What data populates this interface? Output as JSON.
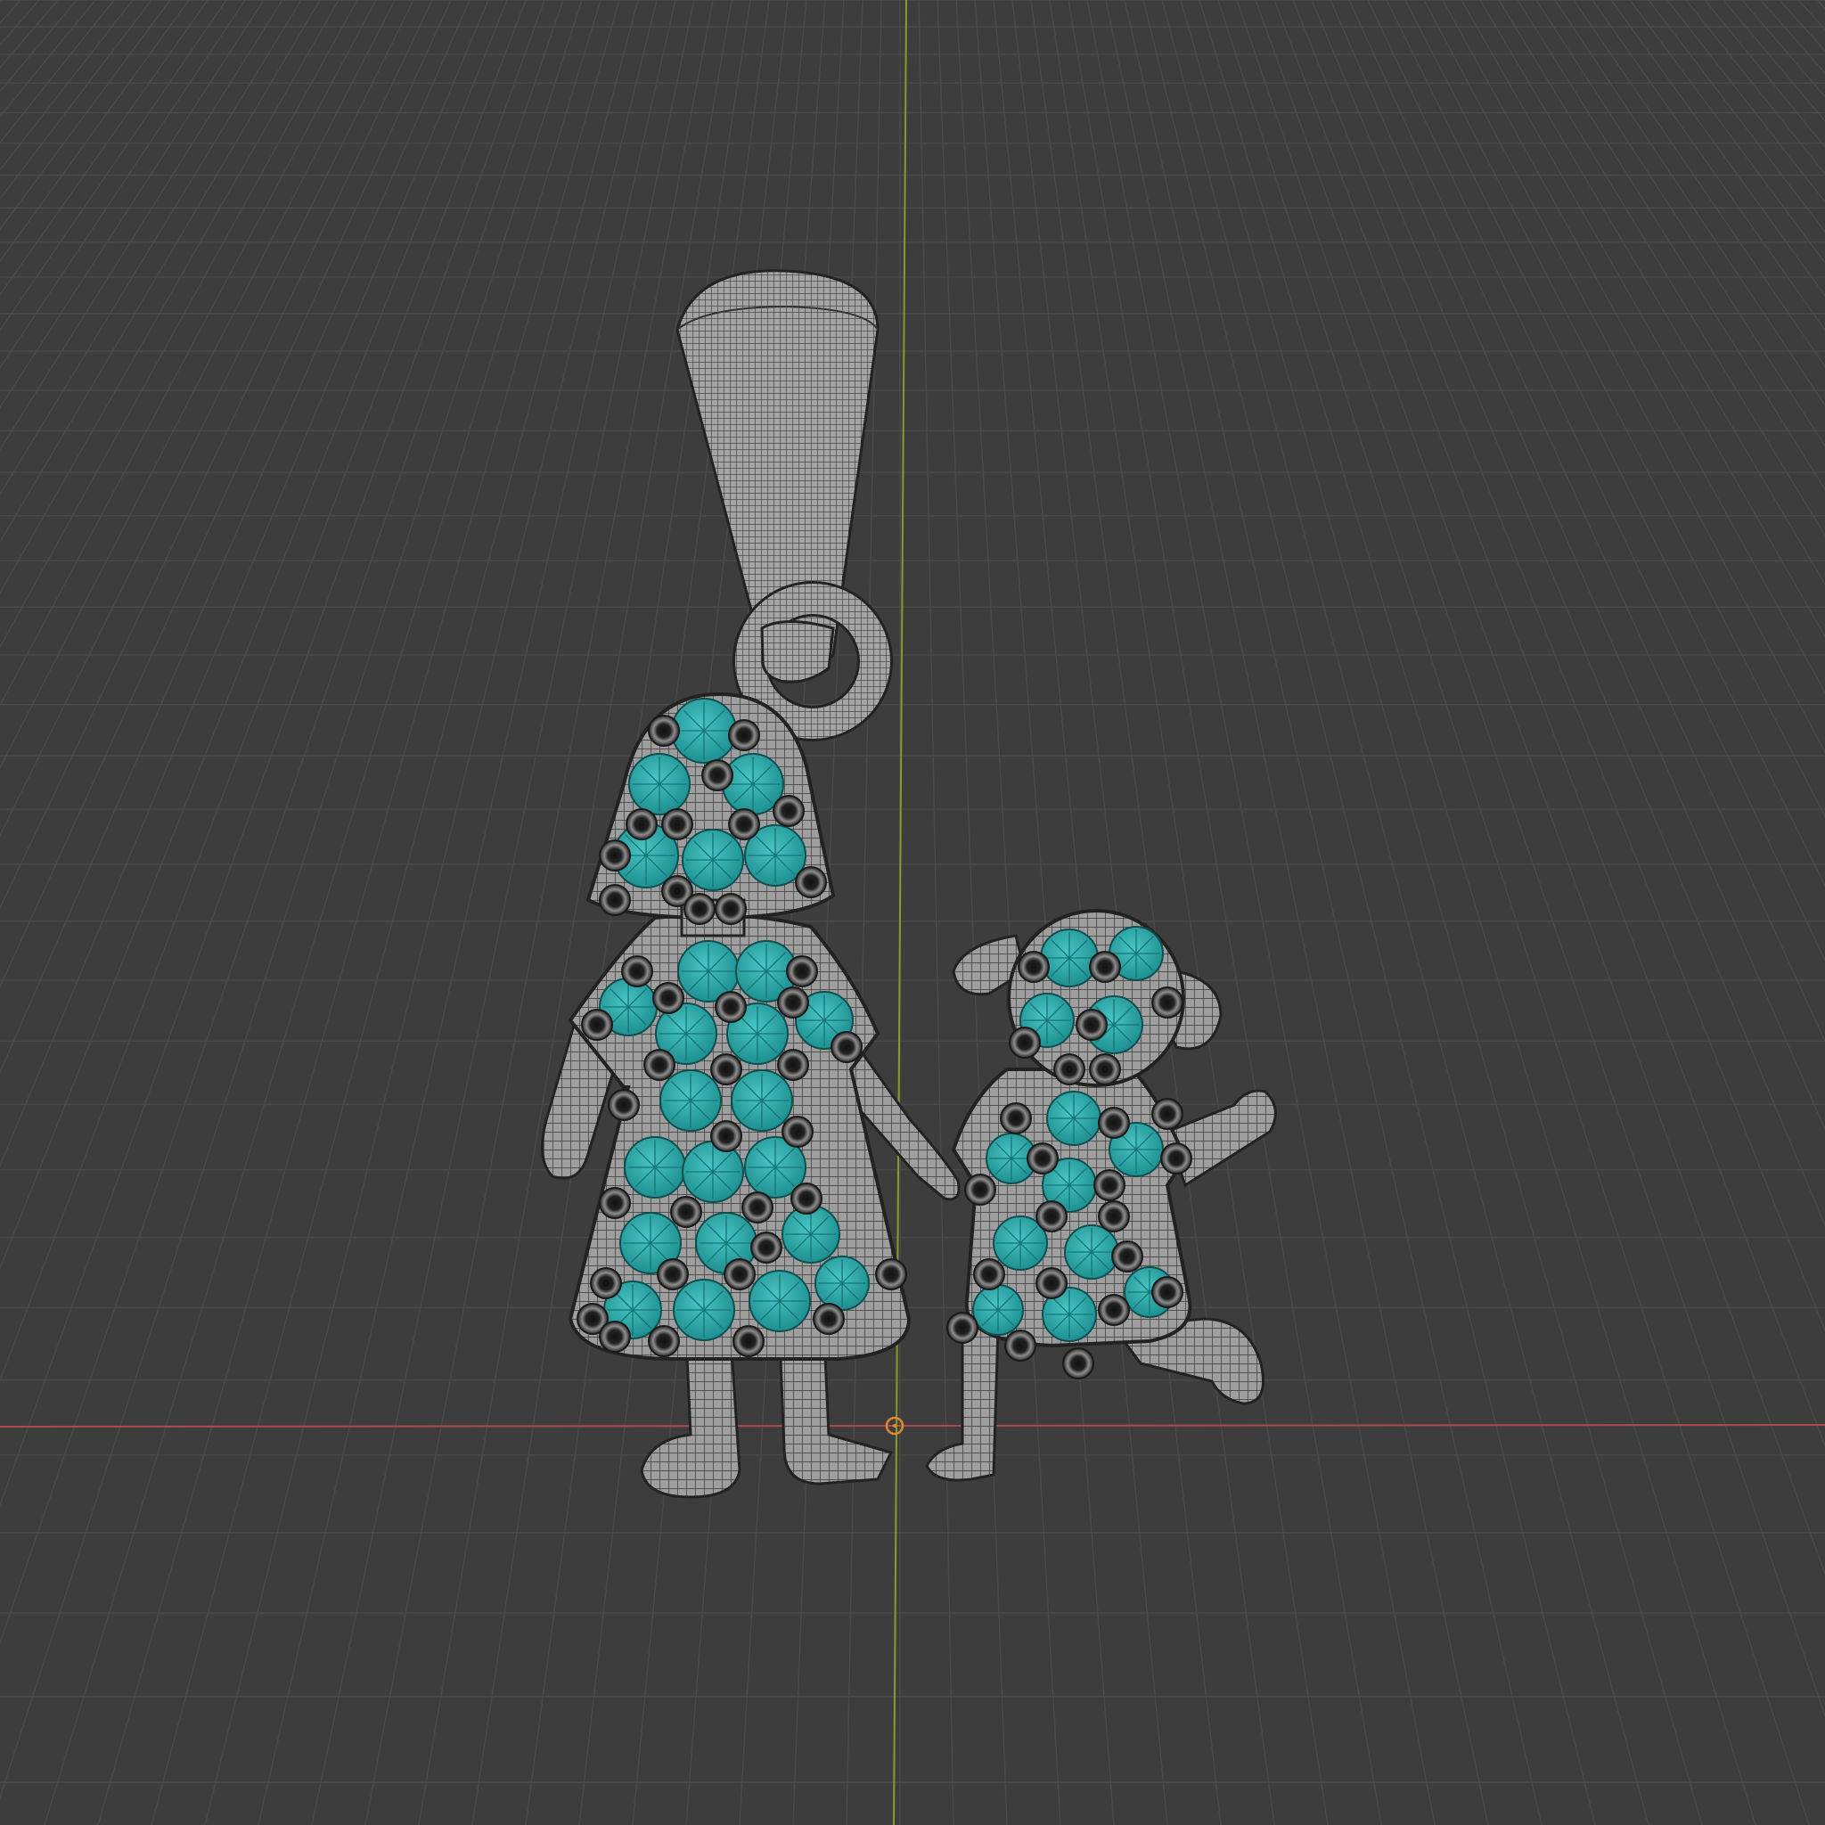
{
  "viewport": {
    "background_color": "#3d3d3d",
    "grid_line_color": "#4a4a4a",
    "x_axis_color": "#b04a4a",
    "y_axis_color": "#8a9a2a",
    "origin_marker_color": "#e08a30"
  },
  "model": {
    "metal_color": "#9a9a9a",
    "wire_color": "#2a2a2a",
    "gem_color": "#2aa7a7",
    "prong_color": "#1e1e1e"
  }
}
